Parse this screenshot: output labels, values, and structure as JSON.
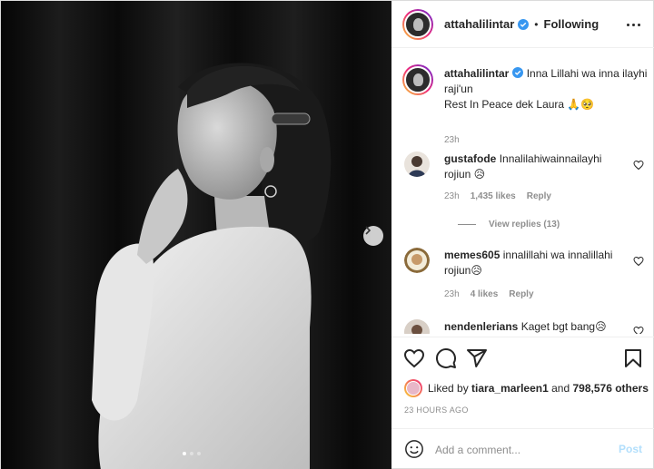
{
  "post": {
    "username": "attahalilintar",
    "separator": "•",
    "follow_status": "Following"
  },
  "caption": {
    "username": "attahalilintar",
    "text": "Inna Lillahi wa inna ilayhi raji'un",
    "text2": "Rest In Peace dek Laura 🙏🥺",
    "time": "23h"
  },
  "comments": [
    {
      "username": "gustafode",
      "text": "Innalilahiwainnailayhi rojiun 😥",
      "time": "23h",
      "likes": "1,435 likes",
      "reply": "Reply",
      "view_replies": "View replies (13)"
    },
    {
      "username": "memes605",
      "text": "innalillahi wa innalillahi rojiun😥",
      "time": "23h",
      "likes": "4 likes",
      "reply": "Reply"
    },
    {
      "username": "nendenlerians",
      "text": "Kaget bgt bang😥"
    }
  ],
  "likes": {
    "prefix": "Liked by",
    "liker": "tiara_marleen1",
    "and": "and",
    "count": "798,576 others"
  },
  "timestamp": "23 HOURS AGO",
  "add_comment": {
    "placeholder": "Add a comment...",
    "post_label": "Post"
  },
  "icons": {
    "heart": "heart-icon",
    "comment": "comment-icon",
    "share": "share-icon",
    "save": "bookmark-icon",
    "more": "more-options-icon",
    "emoji": "emoji-icon",
    "next": "chevron-right-icon",
    "verified": "verified-badge-icon"
  },
  "colors": {
    "verified": "#3897f0",
    "post_disabled": "#b2dffc",
    "secondary_text": "#8e8e8e"
  },
  "carousel": {
    "slides": 3,
    "active": 1
  }
}
